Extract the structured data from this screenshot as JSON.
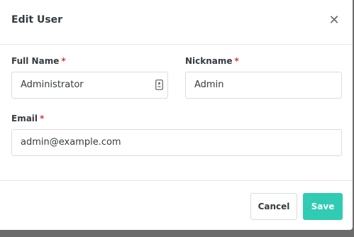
{
  "modal": {
    "title": "Edit User",
    "close_icon": "close-icon",
    "fields": {
      "full_name": {
        "label": "Full Name",
        "required": "*",
        "value": "Administrator",
        "icon": "contact-card-icon"
      },
      "nickname": {
        "label": "Nickname",
        "required": "*",
        "value": "Admin"
      },
      "email": {
        "label": "Email",
        "required": "*",
        "value": "admin@example.com"
      }
    },
    "footer": {
      "cancel_label": "Cancel",
      "save_label": "Save"
    }
  },
  "colors": {
    "accent": "#2fcbb2",
    "required": "#d63939",
    "text": "#353b40",
    "backdrop": "#6b6b6b"
  }
}
